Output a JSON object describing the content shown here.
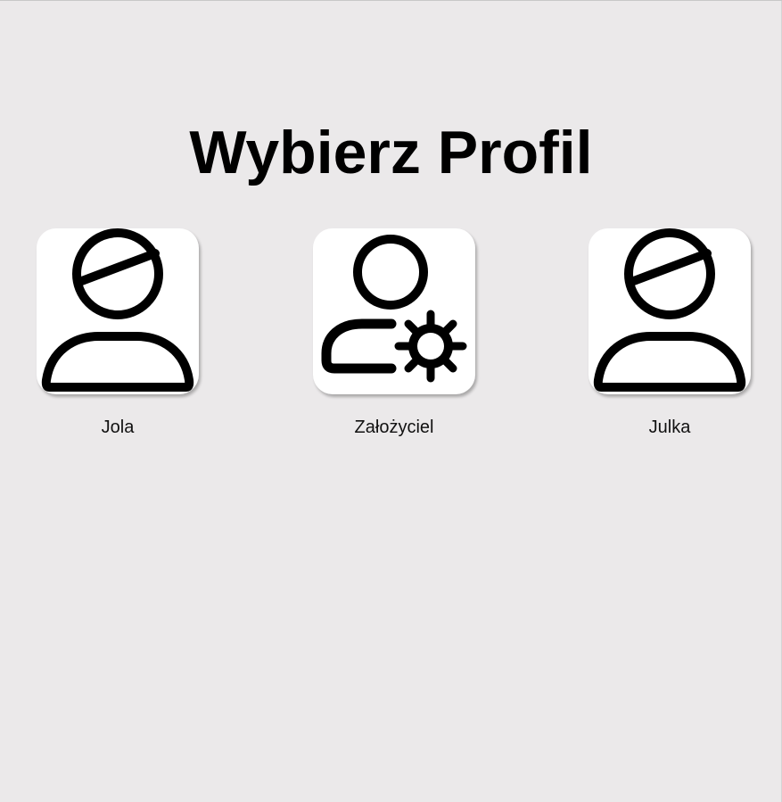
{
  "page": {
    "title": "Wybierz Profil"
  },
  "profiles": [
    {
      "name": "Jola",
      "icon": "user-restricted-icon"
    },
    {
      "name": "Założyciel",
      "icon": "user-settings-icon"
    },
    {
      "name": "Julka",
      "icon": "user-restricted-icon"
    }
  ],
  "colors": {
    "background": "#ebe9ea",
    "tile": "#ffffff",
    "text": "#000000"
  }
}
